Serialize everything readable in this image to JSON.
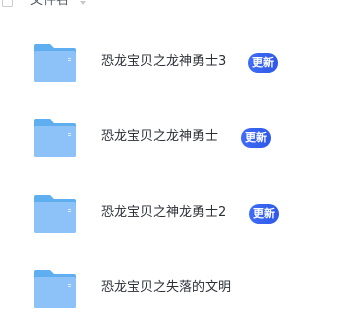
{
  "header": {
    "name_column_label": "文件名",
    "sort_icon": "sort-down-icon"
  },
  "files": [
    {
      "name": "恐龙宝贝之龙神勇士3",
      "badge": "更新",
      "icon": "folder-icon"
    },
    {
      "name": "恐龙宝贝之龙神勇士",
      "badge": "更新",
      "icon": "folder-icon"
    },
    {
      "name": "恐龙宝贝之神龙勇士2",
      "badge": "更新",
      "icon": "folder-icon"
    },
    {
      "name": "恐龙宝贝之失落的文明",
      "badge": "",
      "icon": "folder-icon"
    }
  ],
  "colors": {
    "folder_front": "#8cc2f7",
    "folder_back": "#5faef0",
    "badge_bg": "#3f6cf6",
    "text": "#2b2f36"
  }
}
